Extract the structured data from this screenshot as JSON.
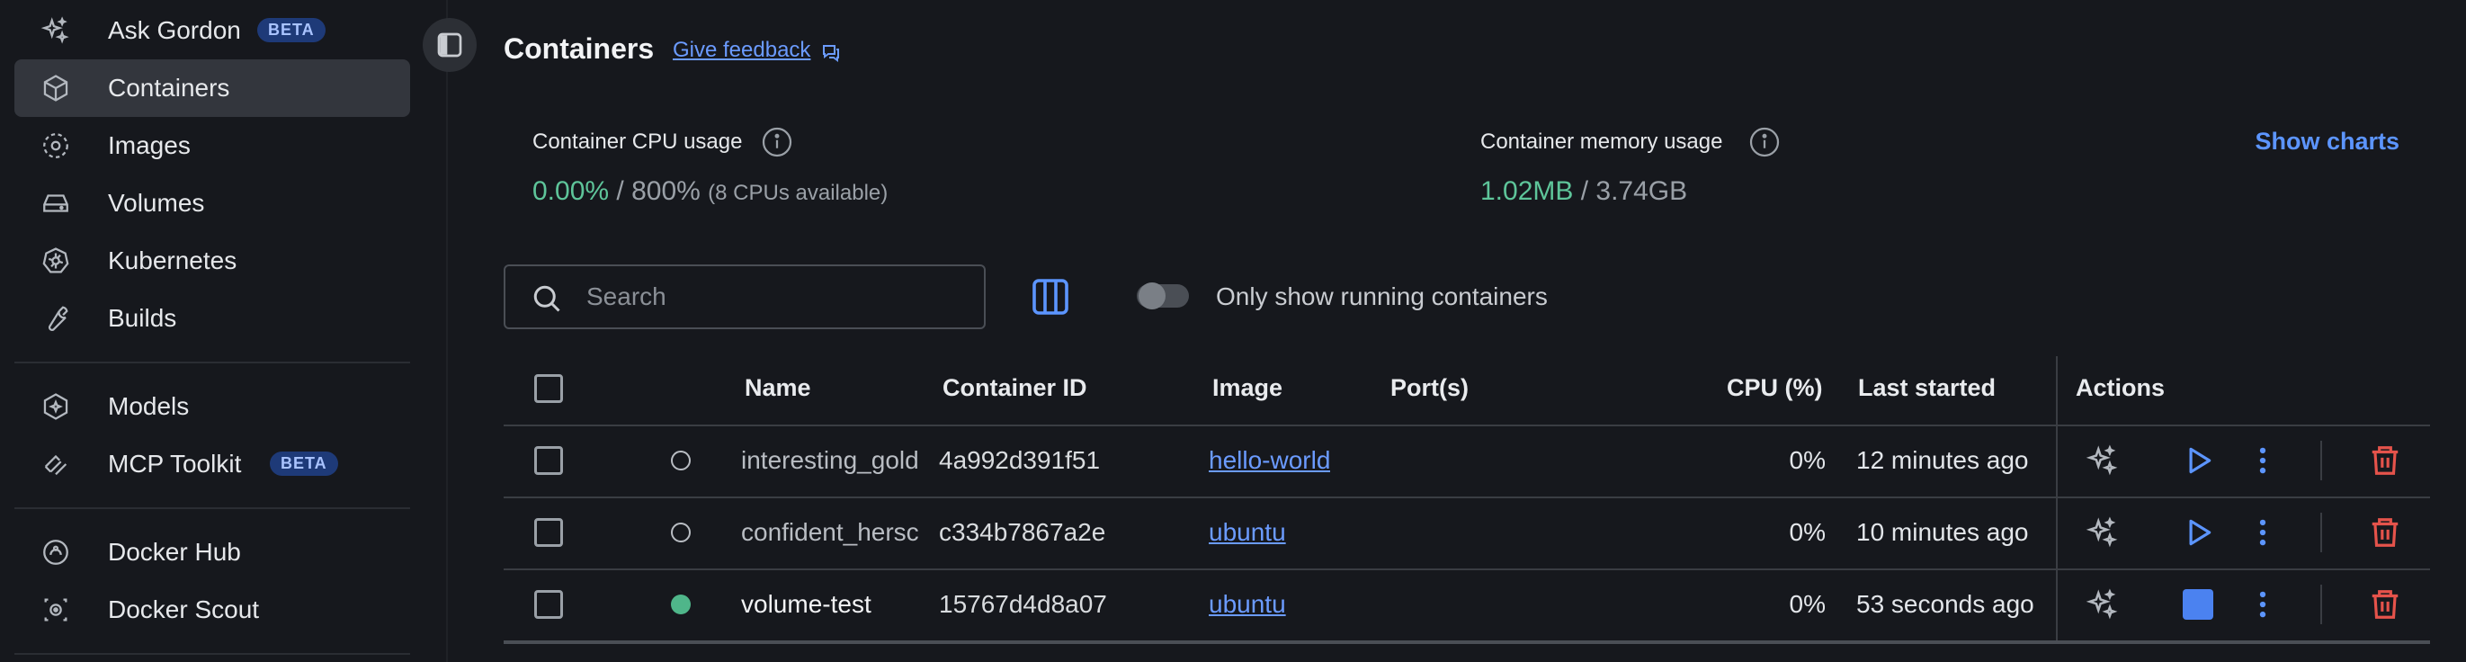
{
  "sidebar": {
    "items": [
      {
        "label": "Ask Gordon",
        "icon": "sparkle-icon",
        "badge": "BETA"
      },
      {
        "label": "Containers",
        "icon": "cube-icon",
        "active": true
      },
      {
        "label": "Images",
        "icon": "image-dashed-icon"
      },
      {
        "label": "Volumes",
        "icon": "hard-drive-icon"
      },
      {
        "label": "Kubernetes",
        "icon": "helm-icon"
      },
      {
        "label": "Builds",
        "icon": "wrench-icon"
      },
      {
        "label": "Models",
        "icon": "model-cube-icon"
      },
      {
        "label": "MCP Toolkit",
        "icon": "toolkit-icon",
        "badge": "BETA"
      },
      {
        "label": "Docker Hub",
        "icon": "hub-icon"
      },
      {
        "label": "Docker Scout",
        "icon": "scout-icon"
      }
    ]
  },
  "header": {
    "title": "Containers",
    "feedback_label": "Give feedback"
  },
  "stats": {
    "cpu_label": "Container CPU usage",
    "cpu_used": "0.00%",
    "cpu_sep": " / ",
    "cpu_total": "800%",
    "cpu_note": "(8 CPUs available)",
    "mem_label": "Container memory usage",
    "mem_used": "1.02MB",
    "mem_sep": " / ",
    "mem_total": "3.74GB",
    "show_charts": "Show charts"
  },
  "toolbar": {
    "search_placeholder": "Search",
    "only_running_label": "Only show running containers"
  },
  "table": {
    "columns": [
      "Name",
      "Container ID",
      "Image",
      "Port(s)",
      "CPU (%)",
      "Last started",
      "Actions"
    ],
    "rows": [
      {
        "name": "interesting_gold",
        "id": "4a992d391f51",
        "image": "hello-world",
        "ports": "",
        "cpu": "0%",
        "started": "12 minutes ago",
        "running": false
      },
      {
        "name": "confident_hersc",
        "id": "c334b7867a2e",
        "image": "ubuntu",
        "ports": "",
        "cpu": "0%",
        "started": "10 minutes ago",
        "running": false
      },
      {
        "name": "volume-test",
        "id": "15767d4d8a07",
        "image": "ubuntu",
        "ports": "",
        "cpu": "0%",
        "started": "53 seconds ago",
        "running": true
      }
    ]
  },
  "colors": {
    "accent": "#5c95ff",
    "running": "#4fb68a",
    "delete": "#e5534b",
    "background": "#16181d"
  }
}
